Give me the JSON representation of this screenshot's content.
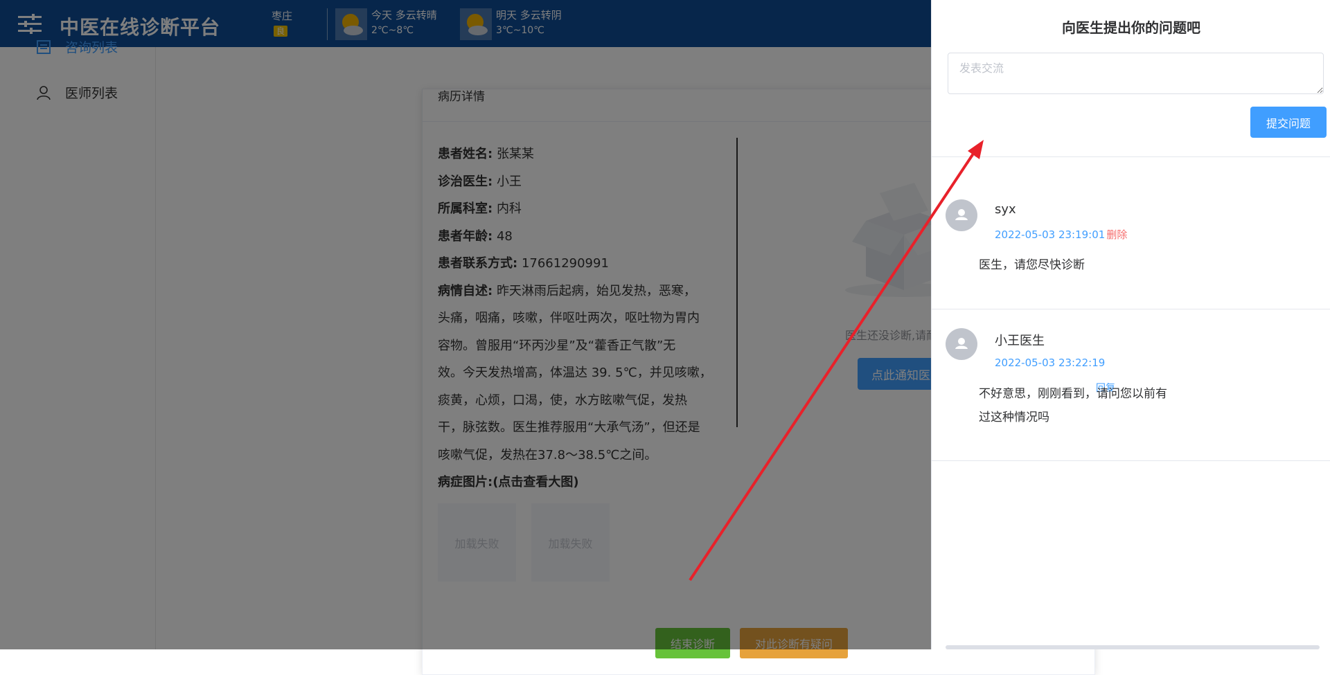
{
  "header": {
    "title": "中医在线诊断平台",
    "weather": {
      "location": "枣庄",
      "aqi": "良",
      "today": {
        "line1": "今天  多云转晴",
        "line2": "2℃~8℃"
      },
      "tomorrow": {
        "line1": "明天  多云转阴",
        "line2": "3℃~10℃"
      }
    }
  },
  "sidebar": {
    "items": [
      {
        "label": "咨询列表",
        "icon": "list-icon",
        "active": true
      },
      {
        "label": "医师列表",
        "icon": "user-icon",
        "active": false
      }
    ]
  },
  "record": {
    "header": "病历详情",
    "fields": [
      {
        "label": "患者姓名:",
        "value": "张某某"
      },
      {
        "label": "诊治医生:",
        "value": "小王"
      },
      {
        "label": "所属科室:",
        "value": "内科"
      },
      {
        "label": "患者年龄:",
        "value": "48"
      },
      {
        "label": "患者联系方式:",
        "value": "17661290991"
      }
    ],
    "description": {
      "label": "病情自述:",
      "lines": [
        "昨天淋雨后起病，始见发热，恶寒，",
        "头痛，咽痛，咳嗽，伴呕吐两次，呕吐物为胃内",
        "容物。曾服用“环丙沙星”及“藿香正气散”无",
        "效。今天发热增高，体温达 39. 5℃，并见咳嗽，",
        "痰黄，心烦，口渴，使，水方眩嗽气促，发热",
        "干，脉弦数。医生推荐服用“大承气汤”，但还是",
        "咳嗽气促，发热在37.8～38.5℃之间。"
      ]
    },
    "images_label": "病症图片:(点击查看大图)",
    "images": [
      "加载失败",
      "加载失败"
    ],
    "empty_text": "医生还没诊断,请耐心等待",
    "notify_button": "点此通知医生",
    "end_button": "结束诊断",
    "question_button": "对此诊断有疑问"
  },
  "drawer": {
    "title": "向医生提出你的问题吧",
    "input_placeholder": "发表交流",
    "submit_button": "提交问题",
    "comments": [
      {
        "name": "syx",
        "time": "2022-05-03 23:19:01",
        "action": "删除",
        "text_lines": [
          "医生，请您尽快诊断"
        ]
      },
      {
        "name": "小王医生",
        "time": "2022-05-03 23:22:19",
        "action": "回复",
        "text_lines": [
          "不好意思，刚刚看到，请问您以前有",
          "过这种情况吗"
        ]
      }
    ]
  },
  "colors": {
    "header_bg": "#0f4d96",
    "primary": "#409eff",
    "success": "#67c23a",
    "warning": "#e6a23c",
    "danger": "#f56c6c",
    "arrow": "#e8212a"
  }
}
